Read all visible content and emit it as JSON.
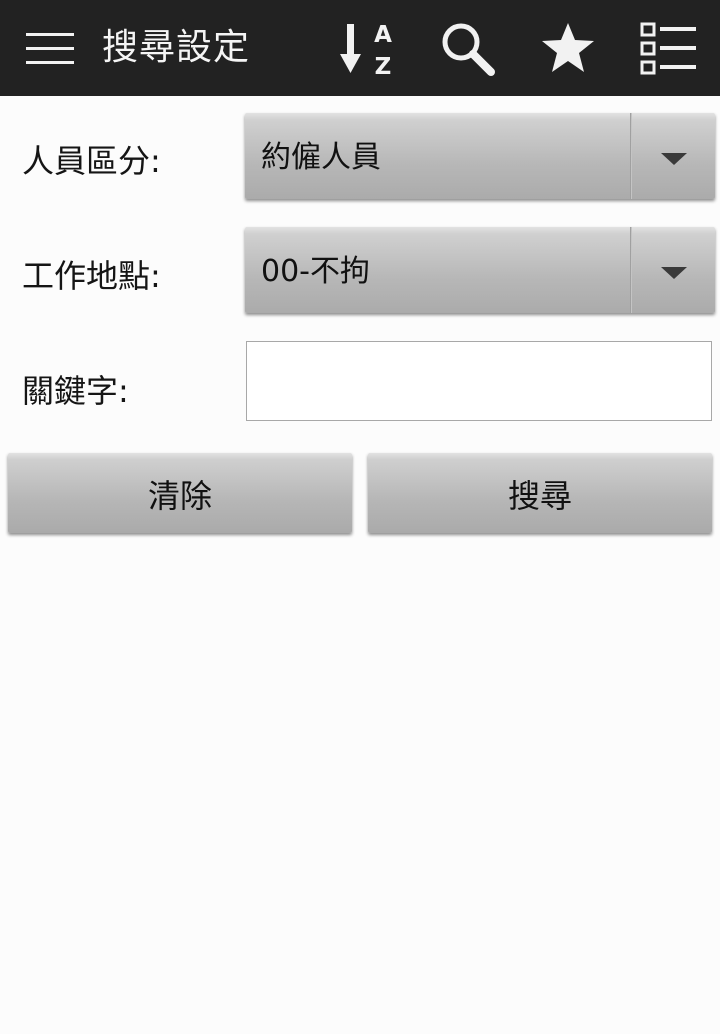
{
  "actionbar": {
    "title": "搜尋設定",
    "icons": [
      "menu-icon",
      "sort-az-icon",
      "search-icon",
      "star-icon",
      "list-icon"
    ],
    "sort_a": "A",
    "sort_z": "Z"
  },
  "form": {
    "personnel_label": "人員區分:",
    "personnel_value": "約僱人員",
    "location_label": "工作地點:",
    "location_value": "00-不拘",
    "keyword_label": "關鍵字:",
    "keyword_value": "",
    "keyword_placeholder": ""
  },
  "buttons": {
    "clear_label": "清除",
    "search_label": "搜尋"
  },
  "colors": {
    "actionbar_bg": "#222222",
    "page_bg": "#fcfcfc",
    "button_gray": "#b6b6b6"
  }
}
